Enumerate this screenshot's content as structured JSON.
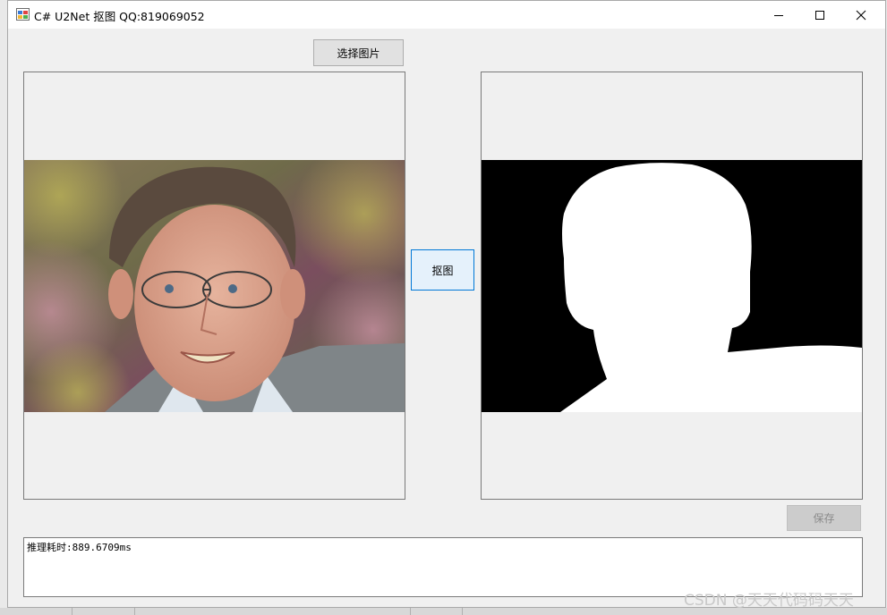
{
  "window": {
    "title": "C# U2Net 抠图 QQ:819069052"
  },
  "buttons": {
    "select_image": "选择图片",
    "matting": "抠图",
    "save": "保存"
  },
  "output": {
    "text": "推理耗时:889.6709ms"
  },
  "watermark": "CSDN @天天代码码天天",
  "colors": {
    "accent": "#0078d7",
    "mask_background": "#000000",
    "mask_foreground": "#ffffff"
  }
}
